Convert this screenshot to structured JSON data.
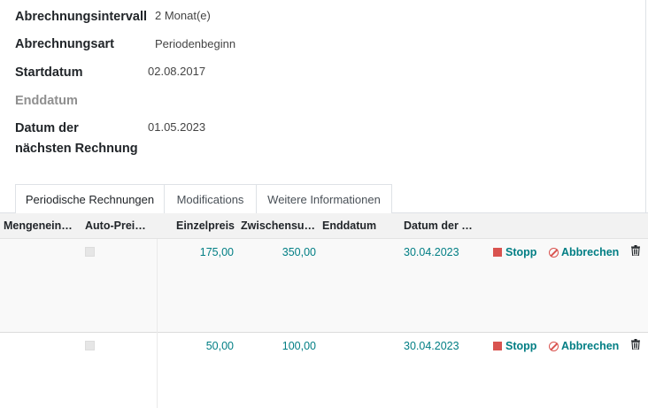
{
  "fields": [
    {
      "label": "Abrechnungsintervall",
      "value": "2  Monat(e)"
    },
    {
      "label": "Abrechnungsart",
      "value": "Periodenbeginn"
    },
    {
      "label": "Startdatum",
      "value": "02.08.2017"
    },
    {
      "label": "Enddatum",
      "value": ""
    },
    {
      "label_line1": "Datum der",
      "label_line2": "nächsten Rechnung",
      "value": "01.05.2023"
    }
  ],
  "tabs": [
    "Periodische Rechnungen",
    "Modifications",
    "Weitere Informationen"
  ],
  "active_tab": "Periodische Rechnungen",
  "table": {
    "headers": [
      "Mengenein…",
      "Auto-Prei…",
      "Einzelpreis",
      "Zwischensu…",
      "Enddatum",
      "Datum der …"
    ],
    "rows": [
      {
        "mengeneinheit": "",
        "auto_preis": false,
        "einzelpreis": "175,00",
        "zwischensumme": "350,00",
        "enddatum": "",
        "datum_der": "30.04.2023"
      },
      {
        "mengeneinheit": "",
        "auto_preis": false,
        "einzelpreis": "50,00",
        "zwischensumme": "100,00",
        "enddatum": "",
        "datum_der": "30.04.2023"
      }
    ],
    "stop_label": "Stopp",
    "cancel_label": "Abbrechen"
  },
  "colors": {
    "accent": "#017e84",
    "danger": "#d9534f",
    "header_bg": "#f2f2f2"
  }
}
